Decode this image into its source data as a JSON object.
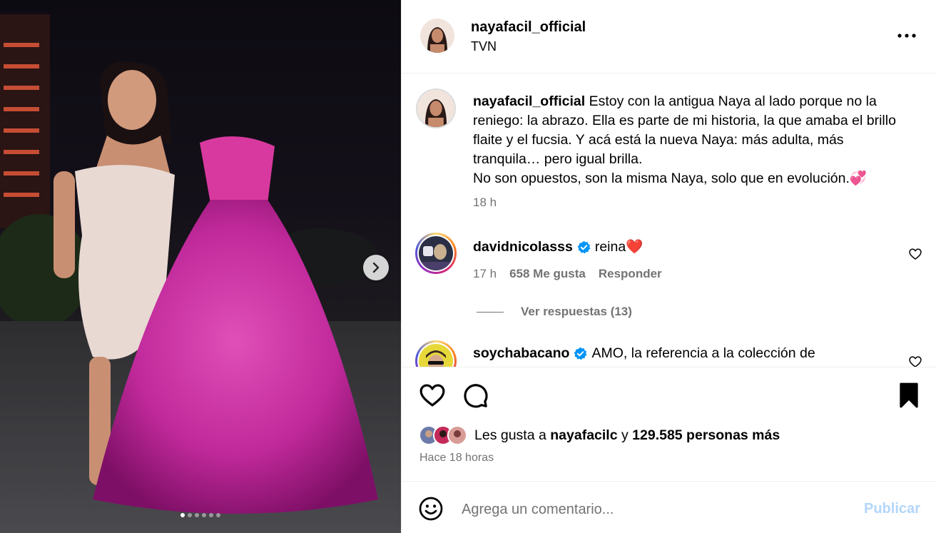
{
  "post": {
    "username": "nayafacil_official",
    "location": "TVN",
    "more_icon": "more-horizontal-icon"
  },
  "media": {
    "slides_total": 6,
    "active_slide": 1,
    "next_icon": "chevron-right-icon"
  },
  "caption": {
    "username": "nayafacil_official",
    "text_line1": " Estoy con la antigua Naya al lado porque no la reniego: la abrazo. Ella es parte de mi historia, la que amaba el brillo flaite y el fucsia. Y acá está la nueva Naya: más adulta, más tranquila… pero igual brilla.",
    "text_line2": "No son opuestos, son la misma Naya, solo que en evolución.💞",
    "time": "18 h"
  },
  "comments": [
    {
      "username": "davidnicolasss",
      "verified": true,
      "text": "reina❤️",
      "time": "17 h",
      "likes": "658 Me gusta",
      "reply_label": "Responder",
      "view_replies": "Ver respuestas (13)"
    },
    {
      "username": "soychabacano",
      "verified": true,
      "text": "AMO, la referencia a la colección de"
    }
  ],
  "actions": {
    "like_icon": "heart-icon",
    "comment_icon": "comment-icon",
    "save_icon": "bookmark-icon"
  },
  "likes": {
    "prefix": "Les gusta a ",
    "user": "nayafacilc",
    "middle": " y ",
    "count": "129.585 personas más"
  },
  "posted_ago": "Hace 18 horas",
  "composer": {
    "placeholder": "Agrega un comentario...",
    "publish_label": "Publicar",
    "emoji_icon": "smiley-icon"
  },
  "colors": {
    "accent": "#0095f6",
    "publish_disabled": "#b3d6fb",
    "secondary_text": "#737373",
    "verified": "#0095f6"
  }
}
